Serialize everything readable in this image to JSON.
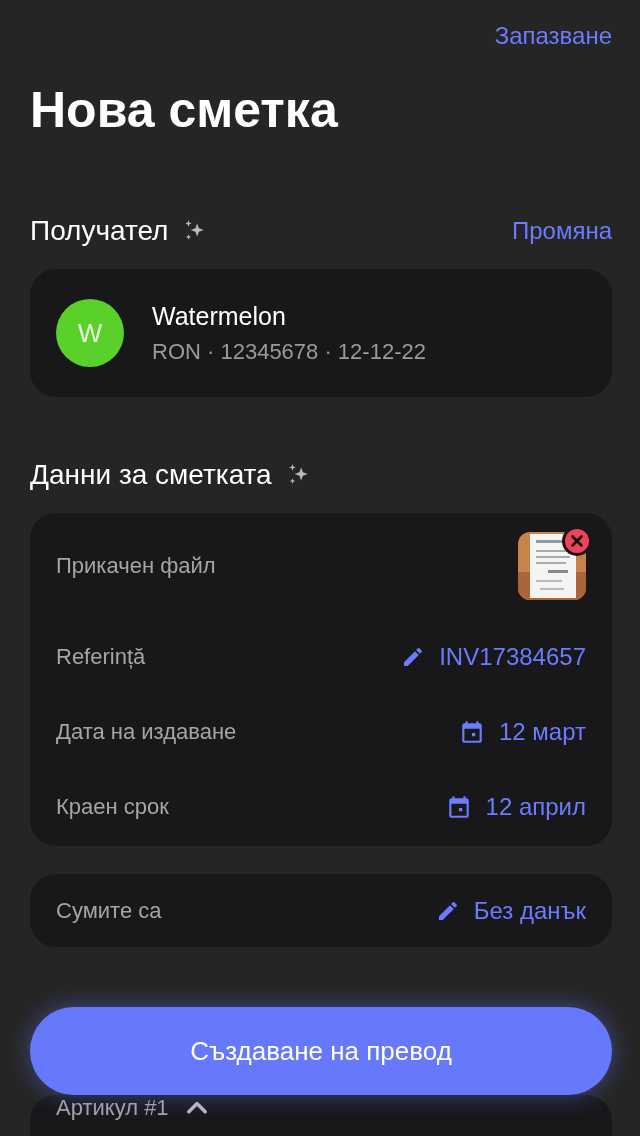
{
  "header": {
    "save_link": "Запазване",
    "title": "Нова сметка"
  },
  "recipient": {
    "heading": "Получател",
    "change_link": "Промяна",
    "avatar_letter": "W",
    "name": "Watermelon",
    "details": "RON · 12345678 · 12-12-22"
  },
  "invoice": {
    "heading": "Данни за сметката",
    "rows": [
      {
        "kind": "attachment",
        "label": "Прикачен файл"
      },
      {
        "kind": "edit",
        "label": "Referință",
        "value": "INV17384657"
      },
      {
        "kind": "date",
        "label": "Дата на издаване",
        "value": "12 март"
      },
      {
        "kind": "date",
        "label": "Краен срок",
        "value": "12 април"
      }
    ]
  },
  "tax": {
    "kind": "edit",
    "label": "Сумите са",
    "value": "Без данък"
  },
  "item": {
    "label": "Артикул #1",
    "expanded": true
  },
  "primary_button": "Създаване на превод"
}
